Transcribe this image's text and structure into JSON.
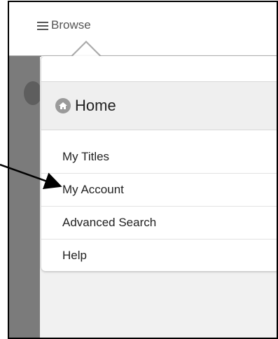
{
  "topbar": {
    "browse_label": "Browse"
  },
  "dropdown": {
    "header_label": "Home",
    "items": [
      {
        "label": "My Titles"
      },
      {
        "label": "My Account"
      },
      {
        "label": "Advanced Search"
      },
      {
        "label": "Help"
      }
    ]
  },
  "annotation": {
    "points_to": "My Account"
  }
}
